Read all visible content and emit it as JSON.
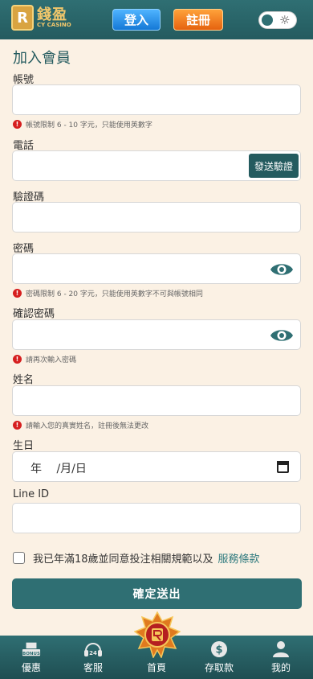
{
  "header": {
    "logo_mark": "R",
    "logo_name": "錢盈",
    "logo_sub": "CY CASINO",
    "login_label": "登入",
    "register_label": "註冊",
    "theme_icon": "sun-icon"
  },
  "form": {
    "title": "加入會員",
    "account": {
      "label": "帳號",
      "value": "",
      "hint": "帳號限制 6 - 10 字元，只能使用英數字"
    },
    "phone": {
      "label": "電話",
      "value": "",
      "send_code_label": "發送驗證"
    },
    "verify": {
      "label": "驗證碼",
      "value": ""
    },
    "password": {
      "label": "密碼",
      "value": "",
      "hint": "密碼限制 6 - 20 字元，只能使用英數字不可與帳號相同"
    },
    "confirm": {
      "label": "確認密碼",
      "value": "",
      "hint": "請再次輸入密碼"
    },
    "name": {
      "label": "姓名",
      "value": "",
      "hint": "請輸入您的真實姓名，註冊後無法更改"
    },
    "birthday": {
      "label": "生日",
      "year": "年",
      "month": "/月/",
      "day": "日"
    },
    "line": {
      "label": "Line ID",
      "value": ""
    },
    "agree_text": "我已年滿18歲並同意投注相關規範以及",
    "terms_label": "服務條款",
    "submit_label": "確定送出"
  },
  "nav": {
    "items": [
      {
        "label": "優惠",
        "icon": "bonus-icon"
      },
      {
        "label": "客服",
        "icon": "headset-icon"
      },
      {
        "label": "首頁",
        "icon": "home-emblem-icon"
      },
      {
        "label": "存取款",
        "icon": "dollar-icon"
      },
      {
        "label": "我的",
        "icon": "user-icon"
      }
    ],
    "bonus_badge": "BONUS",
    "support_badge": "24"
  },
  "colors": {
    "primary": "#2f6f73",
    "background": "#fbf1e4",
    "error": "#d61f1f",
    "login": "#1478d6",
    "register": "#e5620f"
  }
}
